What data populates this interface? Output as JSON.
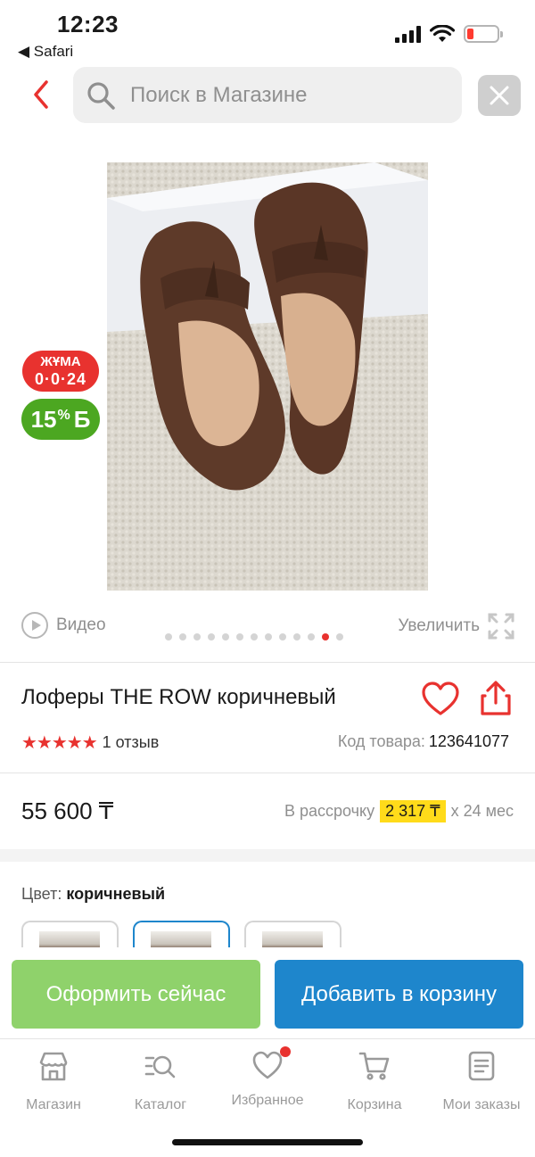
{
  "status": {
    "time": "12:23",
    "back_app": "◀ Safari"
  },
  "search": {
    "placeholder": "Поиск в Магазине"
  },
  "badges": {
    "day": "ЖҰМА",
    "day_count": "0·0·24",
    "bonus_percent": "15",
    "bonus_sup": "%",
    "bonus_symbol": "Б"
  },
  "media": {
    "video_label": "Видео",
    "zoom_label": "Увеличить",
    "slides_total": 13,
    "slide_active": 12
  },
  "product": {
    "title": "Лоферы THE ROW коричневый",
    "stars": "★★★★★",
    "reviews": "1 отзыв",
    "sku_label": "Код товара:",
    "sku_value": "123641077",
    "price": "55 600 ₸",
    "installment_prefix": "В рассрочку",
    "installment_amount": "2 317 ₸",
    "installment_suffix": "х 24 мес"
  },
  "color": {
    "label": "Цвет:",
    "value": "коричневый"
  },
  "actions": {
    "buy_now": "Оформить сейчас",
    "add_to_cart": "Добавить в корзину"
  },
  "tabs": [
    {
      "label": "Магазин",
      "icon": "shop-icon"
    },
    {
      "label": "Каталог",
      "icon": "catalog-search-icon"
    },
    {
      "label": "Избранное",
      "icon": "heart-icon"
    },
    {
      "label": "Корзина",
      "icon": "cart-icon"
    },
    {
      "label": "Мои заказы",
      "icon": "orders-icon"
    }
  ],
  "colors": {
    "accent_red": "#e8322f",
    "primary_blue": "#1e86cc",
    "buy_green": "#8fd26b",
    "bonus_green": "#4ca721",
    "highlight_yellow": "#ffdb1a"
  }
}
